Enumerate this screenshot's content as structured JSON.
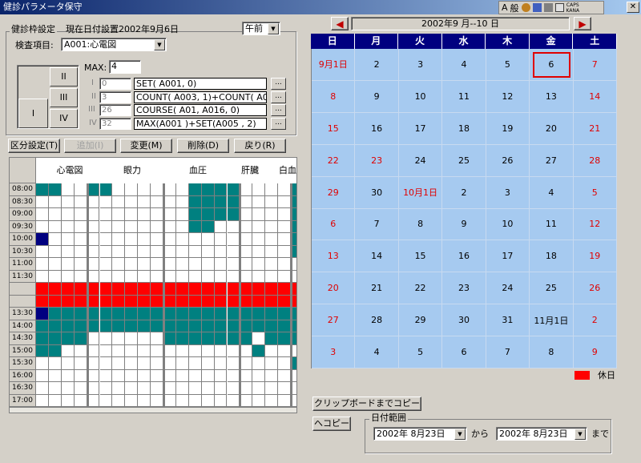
{
  "window": {
    "title": "健診パラメータ保守",
    "close": "✕"
  },
  "ime": {
    "a": "A",
    "kan": "般",
    "caps": "CAPS",
    "kana": "KANA"
  },
  "frame": {
    "title": "健診枠設定",
    "date_label": "現在日付設置2002年9月6日",
    "ampm": "午前",
    "exam_label": "検査項目:",
    "exam_value": "A001:心電図",
    "max_label": "MAX:",
    "max_value": "4"
  },
  "tabs": {
    "t1": "I",
    "t2": "II",
    "t3": "III",
    "t4": "IV"
  },
  "rules": [
    {
      "label": "I",
      "count": "0",
      "formula": "SET( A001, 0)"
    },
    {
      "label": "II",
      "count": "3",
      "formula": "COUNT( A003, 1)+COUNT( A0"
    },
    {
      "label": "III",
      "count": "26",
      "formula": "COURSE( A01, A016, 0)"
    },
    {
      "label": "IV",
      "count": "32",
      "formula": "MAX(A001 )+SET(A005 , 2)"
    }
  ],
  "dots": "...",
  "buttons": {
    "classify": "区分設定(T)",
    "add": "追加(I)",
    "change": "変更(M)",
    "delete": "削除(D)",
    "back": "戻り(R)",
    "copy_clip": "クリップボードまでコピー",
    "copy_to": "へコピー"
  },
  "schedule": {
    "columns": [
      "心電図",
      "眼力",
      "血圧",
      "肝臓",
      "白血"
    ],
    "times": [
      "08:00",
      "08:30",
      "09:00",
      "09:30",
      "10:00",
      "10:30",
      "11:00",
      "11:30",
      "",
      "",
      "13:30",
      "14:00",
      "14:30",
      "15:00",
      "15:30",
      "16:00",
      "16:30",
      "17:00"
    ]
  },
  "calendar": {
    "header": "2002年9  月--10  日",
    "weekdays": [
      "日",
      "月",
      "火",
      "水",
      "木",
      "金",
      "土"
    ],
    "weeks": [
      [
        "9月1日",
        "2",
        "3",
        "4",
        "5",
        "6",
        "7"
      ],
      [
        "8",
        "9",
        "10",
        "11",
        "12",
        "13",
        "14"
      ],
      [
        "15",
        "16",
        "17",
        "18",
        "19",
        "20",
        "21"
      ],
      [
        "22",
        "23",
        "24",
        "25",
        "26",
        "27",
        "28"
      ],
      [
        "29",
        "30",
        "10月1日",
        "2",
        "3",
        "4",
        "5"
      ],
      [
        "6",
        "7",
        "8",
        "9",
        "10",
        "11",
        "12"
      ],
      [
        "13",
        "14",
        "15",
        "16",
        "17",
        "18",
        "19"
      ],
      [
        "20",
        "21",
        "22",
        "23",
        "24",
        "25",
        "26"
      ],
      [
        "27",
        "28",
        "29",
        "30",
        "31",
        "11月1日",
        "2"
      ],
      [
        "3",
        "4",
        "5",
        "6",
        "7",
        "8",
        "9"
      ]
    ],
    "holiday_label": "休日",
    "colors": {
      "header": "#000080",
      "body": "#a6caf0",
      "holiday": "#ff0000",
      "filled": "#008080",
      "selected": "#000080"
    }
  },
  "daterange": {
    "title": "日付範囲",
    "from": "2002年  8月23日",
    "from_suffix": "から",
    "to": "2002年  8月23日",
    "to_suffix": "まで"
  }
}
